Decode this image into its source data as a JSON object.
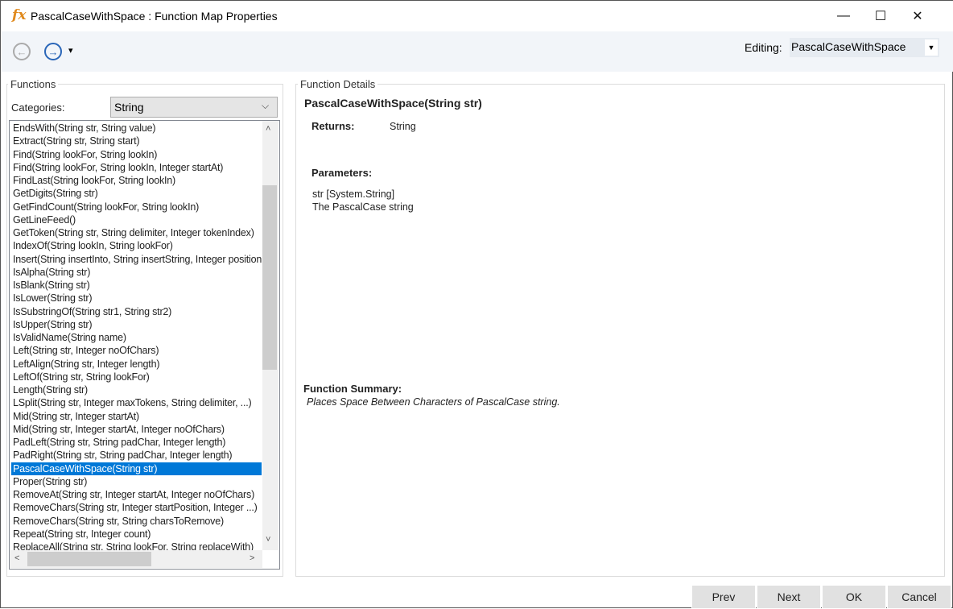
{
  "window": {
    "title": "PascalCaseWithSpace : Function Map Properties",
    "icon": "fx-icon",
    "minimize": "—",
    "maximize": "☐",
    "close": "✕"
  },
  "toolbar": {
    "back": "←",
    "forward": "→",
    "dropdown": "▾",
    "editing_label": "Editing:",
    "editing_value": "PascalCaseWithSpace"
  },
  "functions": {
    "legend": "Functions",
    "categories_label": "Categories:",
    "category": "String",
    "items": [
      "EndsWith(String str, String value)",
      "Extract(String str, String start)",
      "Find(String lookFor, String lookIn)",
      "Find(String lookFor, String lookIn, Integer startAt)",
      "FindLast(String lookFor, String lookIn)",
      "GetDigits(String str)",
      "GetFindCount(String lookFor, String lookIn)",
      "GetLineFeed()",
      "GetToken(String str, String delimiter, Integer tokenIndex)",
      "IndexOf(String lookIn, String lookFor)",
      "Insert(String insertInto, String insertString, Integer position)",
      "IsAlpha(String str)",
      "IsBlank(String str)",
      "IsLower(String str)",
      "IsSubstringOf(String str1, String str2)",
      "IsUpper(String str)",
      "IsValidName(String name)",
      "Left(String str, Integer noOfChars)",
      "LeftAlign(String str, Integer length)",
      "LeftOf(String str, String lookFor)",
      "Length(String str)",
      "LSplit(String str, Integer maxTokens, String delimiter, ...)",
      "Mid(String str, Integer startAt)",
      "Mid(String str, Integer startAt, Integer noOfChars)",
      "PadLeft(String str, String padChar, Integer length)",
      "PadRight(String str, String padChar, Integer length)",
      "PascalCaseWithSpace(String str)",
      "Proper(String str)",
      "RemoveAt(String str, Integer startAt, Integer noOfChars)",
      "RemoveChars(String str, Integer startPosition, Integer ...)",
      "RemoveChars(String str, String charsToRemove)",
      "Repeat(String str, Integer count)",
      "ReplaceAll(String str, String lookFor, String replaceWith)"
    ],
    "selected_index": 26
  },
  "details": {
    "legend": "Function Details",
    "signature": "PascalCaseWithSpace(String str)",
    "returns_label": "Returns:",
    "returns_value": "String",
    "parameters_label": "Parameters:",
    "param_type": "str [System.String]",
    "param_desc": "The PascalCase string",
    "summary_label": "Function Summary:",
    "summary": "Places Space Between Characters of PascalCase string."
  },
  "buttons": {
    "prev": "Prev",
    "next": "Next",
    "ok": "OK",
    "cancel": "Cancel"
  }
}
